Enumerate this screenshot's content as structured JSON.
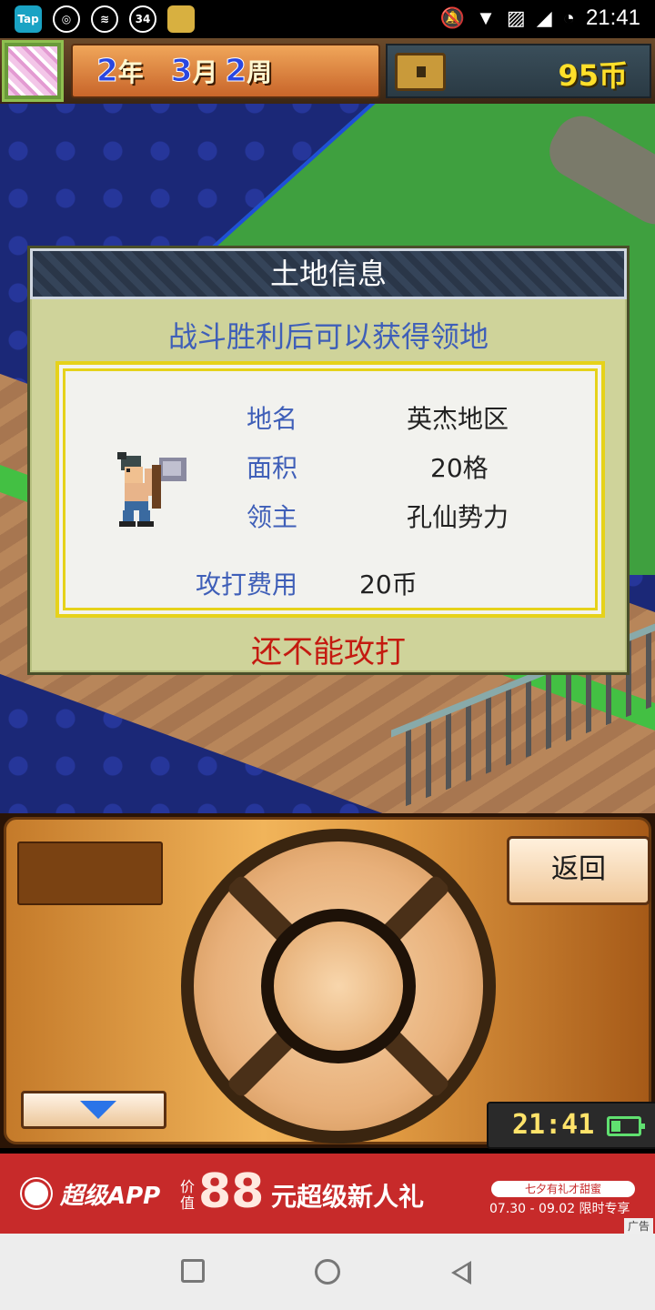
{
  "status_bar": {
    "left_icons": [
      "tap-app-icon",
      "netease-music-icon",
      "mobile-network-icon",
      "notification-count-icon",
      "game-app-icon"
    ],
    "tap_label": "Tap",
    "badge_count": "34",
    "time": "21:41"
  },
  "hud": {
    "year_num": "2",
    "year_unit": "年",
    "month_num": "3",
    "month_unit": "月",
    "week_num": "2",
    "week_unit": "周",
    "coins": "95币"
  },
  "dialog": {
    "title": "土地信息",
    "subtitle": "战斗胜利后可以获得领地",
    "fields": [
      {
        "label": "地名",
        "value": "英杰地区"
      },
      {
        "label": "面积",
        "value": "20格"
      },
      {
        "label": "领主",
        "value": "孔仙势力"
      }
    ],
    "cost_label": "攻打费用",
    "cost_value": "20币",
    "warning": "还不能攻打"
  },
  "controller": {
    "back_label": "返回",
    "clock": "21:41"
  },
  "ad": {
    "app_text": "超级APP",
    "price_prefix": "价值",
    "price": "88",
    "gift_text": "元超级新人礼",
    "tag_text": "七夕有礼才甜蜜",
    "date_text": "07.30 - 09.02 限时专享",
    "ad_label": "广告"
  }
}
